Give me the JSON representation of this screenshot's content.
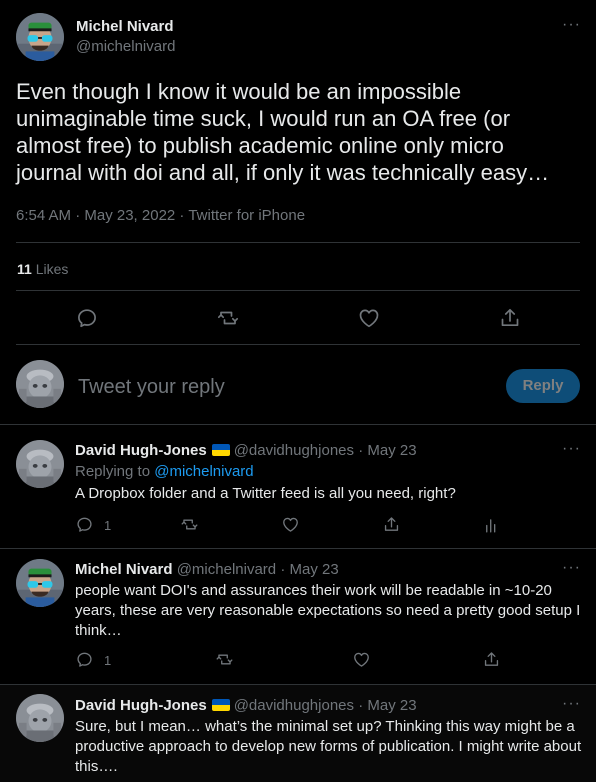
{
  "main_tweet": {
    "author_name": "Michel Nivard",
    "author_handle": "@michelnivard",
    "text": "Even though I know it would be an impossible unimaginable time suck, I would run an OA free (or almost free) to publish academic online only micro journal with doi and all, if only it was technically easy…",
    "timestamp": "6:54 AM · May 23, 2022 · Twitter for iPhone",
    "likes_count": "11",
    "likes_label": "Likes",
    "more_glyph": "···"
  },
  "compose": {
    "placeholder": "Tweet your reply",
    "reply_button": "Reply",
    "accent": "#1d9bf0"
  },
  "replies": [
    {
      "author_name": "David Hugh-Jones",
      "author_handle": "@davidhughjones",
      "date": "· May 23",
      "replying_label": "Replying to",
      "replying_handle": "@michelnivard",
      "text": "A Dropbox folder and a Twitter feed is all you need, right?",
      "reply_count": "1"
    },
    {
      "author_name": "Michel Nivard",
      "author_handle": "@michelnivard",
      "date": "· May 23",
      "text": "people want DOI's and assurances their work will be readable in ~10-20 years, these are very reasonable expectations so need a pretty good setup I think…",
      "reply_count": "1"
    },
    {
      "author_name": "David Hugh-Jones",
      "author_handle": "@davidhughjones",
      "date": "· May 23",
      "text": "Sure, but I mean… what’s the minimal set up? Thinking this way might be a productive approach to develop new forms of publication. I might write about this…."
    }
  ],
  "icons": {
    "reply": "reply-bubble-icon",
    "retweet": "retweet-icon",
    "like": "heart-icon",
    "share": "share-icon",
    "analytics": "analytics-icon",
    "flag": "ukraine-flag-icon"
  },
  "colors": {
    "background": "#000000",
    "text": "#e7e9ea",
    "muted": "#71767b",
    "divider": "#2f3336",
    "link": "#1d9bf0",
    "flag_blue": "#0057b7",
    "flag_yellow": "#ffd700"
  }
}
